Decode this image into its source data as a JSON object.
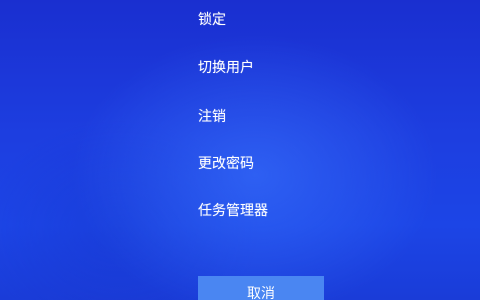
{
  "menu": {
    "items": [
      {
        "label": "锁定"
      },
      {
        "label": "切换用户"
      },
      {
        "label": "注销"
      },
      {
        "label": "更改密码"
      },
      {
        "label": "任务管理器"
      }
    ]
  },
  "cancel": {
    "label": "取消"
  },
  "colors": {
    "background": "#1d3ee0",
    "button": "#4a86f2",
    "text": "#ffffff"
  }
}
